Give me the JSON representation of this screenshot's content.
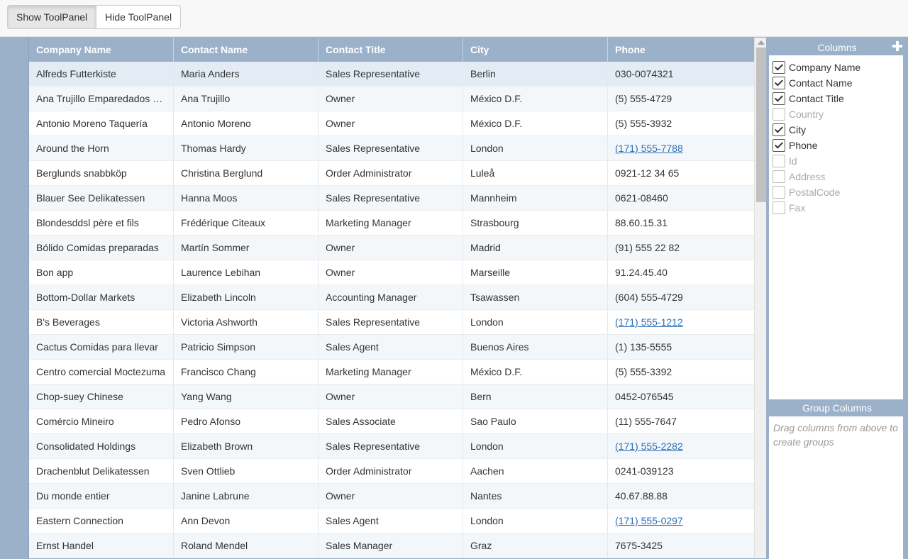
{
  "toolbar": {
    "show_label": "Show ToolPanel",
    "hide_label": "Hide ToolPanel"
  },
  "grid": {
    "columns": [
      "Company Name",
      "Contact Name",
      "Contact Title",
      "City",
      "Phone"
    ],
    "rows": [
      [
        "Alfreds Futterkiste",
        "Maria Anders",
        "Sales Representative",
        "Berlin",
        "030-0074321"
      ],
      [
        "Ana Trujillo Emparedados y helados",
        "Ana Trujillo",
        "Owner",
        "México D.F.",
        "(5) 555-4729"
      ],
      [
        "Antonio Moreno Taquería",
        "Antonio Moreno",
        "Owner",
        "México D.F.",
        "(5) 555-3932"
      ],
      [
        "Around the Horn",
        "Thomas Hardy",
        "Sales Representative",
        "London",
        "(171) 555-7788"
      ],
      [
        "Berglunds snabbköp",
        "Christina Berglund",
        "Order Administrator",
        "Luleå",
        "0921-12 34 65"
      ],
      [
        "Blauer See Delikatessen",
        "Hanna Moos",
        "Sales Representative",
        "Mannheim",
        "0621-08460"
      ],
      [
        "Blondesddsl père et fils",
        "Frédérique Citeaux",
        "Marketing Manager",
        "Strasbourg",
        "88.60.15.31"
      ],
      [
        "Bólido Comidas preparadas",
        "Martín Sommer",
        "Owner",
        "Madrid",
        "(91) 555 22 82"
      ],
      [
        "Bon app",
        "Laurence Lebihan",
        "Owner",
        "Marseille",
        "91.24.45.40"
      ],
      [
        "Bottom-Dollar Markets",
        "Elizabeth Lincoln",
        "Accounting Manager",
        "Tsawassen",
        "(604) 555-4729"
      ],
      [
        "B's Beverages",
        "Victoria Ashworth",
        "Sales Representative",
        "London",
        "(171) 555-1212"
      ],
      [
        "Cactus Comidas para llevar",
        "Patricio Simpson",
        "Sales Agent",
        "Buenos Aires",
        "(1) 135-5555"
      ],
      [
        "Centro comercial Moctezuma",
        "Francisco Chang",
        "Marketing Manager",
        "México D.F.",
        "(5) 555-3392"
      ],
      [
        "Chop-suey Chinese",
        "Yang Wang",
        "Owner",
        "Bern",
        "0452-076545"
      ],
      [
        "Comércio Mineiro",
        "Pedro Afonso",
        "Sales Associate",
        "Sao Paulo",
        "(11) 555-7647"
      ],
      [
        "Consolidated Holdings",
        "Elizabeth Brown",
        "Sales Representative",
        "London",
        "(171) 555-2282"
      ],
      [
        "Drachenblut Delikatessen",
        "Sven Ottlieb",
        "Order Administrator",
        "Aachen",
        "0241-039123"
      ],
      [
        "Du monde entier",
        "Janine Labrune",
        "Owner",
        "Nantes",
        "40.67.88.88"
      ],
      [
        "Eastern Connection",
        "Ann Devon",
        "Sales Agent",
        "London",
        "(171) 555-0297"
      ],
      [
        "Ernst Handel",
        "Roland Mendel",
        "Sales Manager",
        "Graz",
        "7675-3425"
      ]
    ],
    "link_phones": [
      "(171) 555-7788",
      "(171) 555-1212",
      "(171) 555-2282",
      "(171) 555-0297"
    ]
  },
  "toolpanel": {
    "columns_title": "Columns",
    "columns": [
      {
        "label": "Company Name",
        "checked": true
      },
      {
        "label": "Contact Name",
        "checked": true
      },
      {
        "label": "Contact Title",
        "checked": true
      },
      {
        "label": "Country",
        "checked": false
      },
      {
        "label": "City",
        "checked": true
      },
      {
        "label": "Phone",
        "checked": true
      },
      {
        "label": "Id",
        "checked": false
      },
      {
        "label": "Address",
        "checked": false
      },
      {
        "label": "PostalCode",
        "checked": false
      },
      {
        "label": "Fax",
        "checked": false
      }
    ],
    "group_title": "Group Columns",
    "group_placeholder": "Drag columns from above to create groups"
  },
  "colors": {
    "header": "#9bb0c9",
    "link": "#2a6ebb"
  },
  "icons": {
    "add": "plus-icon",
    "check": "checkmark-icon",
    "scroll": "scroll-up-arrow-icon"
  }
}
